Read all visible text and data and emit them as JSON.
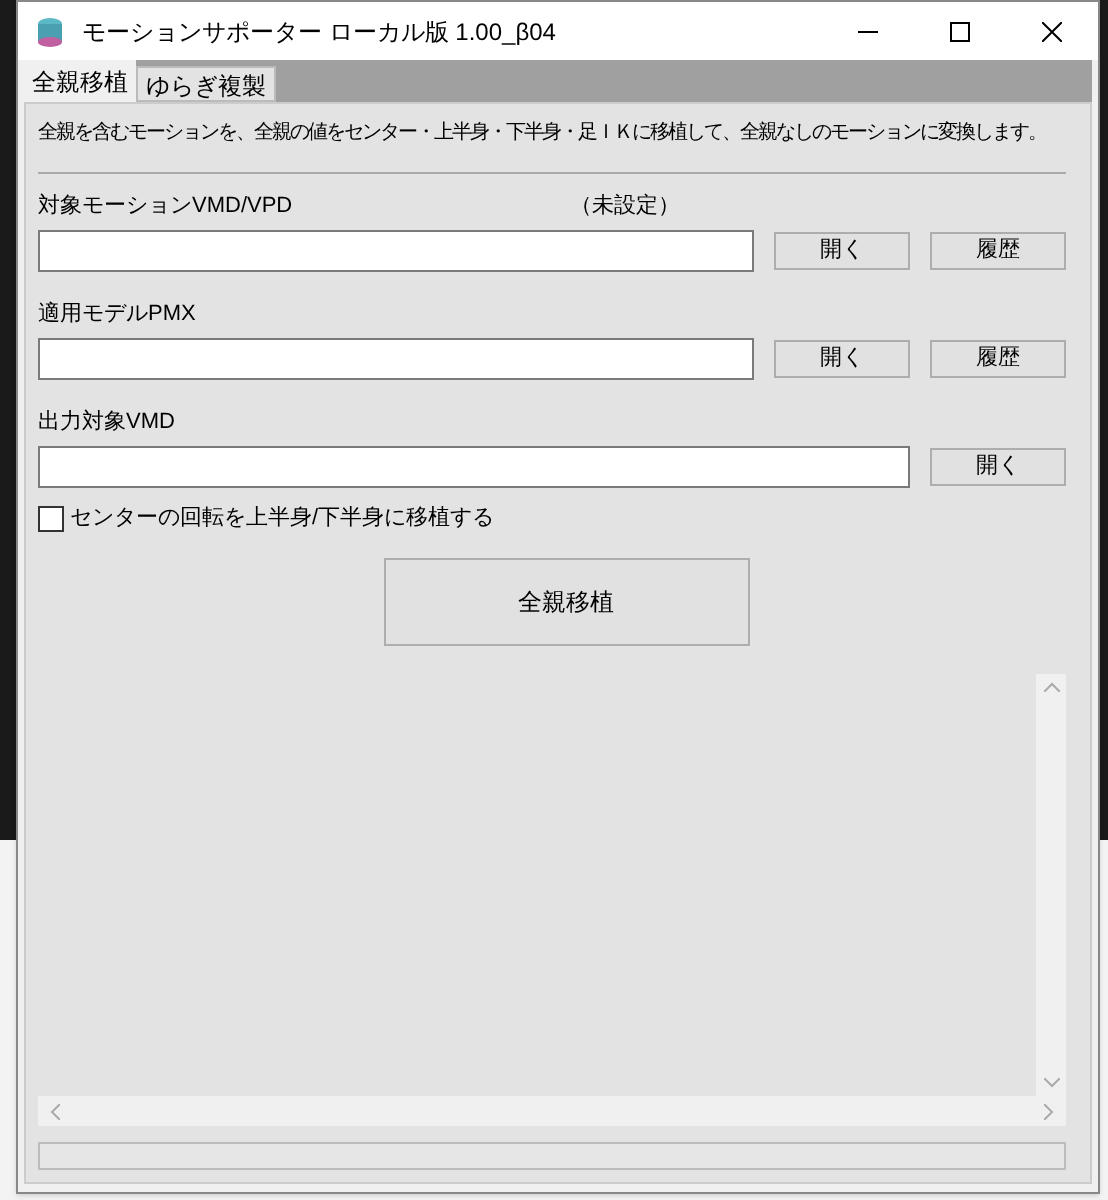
{
  "window": {
    "title": "モーションサポーター ローカル版 1.00_β04"
  },
  "tabs": [
    {
      "label": "全親移植",
      "selected": true
    },
    {
      "label": "ゆらぎ複製",
      "selected": false
    }
  ],
  "description": "全親を含むモーションを、全親の値をセンター・上半身・下半身・足ＩＫに移植して、全親なしのモーションに変換します。",
  "fields": [
    {
      "label": "対象モーションVMD/VPD",
      "status": "（未設定）",
      "buttons": [
        "開く",
        "履歴"
      ]
    },
    {
      "label": "適用モデルPMX",
      "buttons": [
        "開く",
        "履歴"
      ]
    },
    {
      "label": "出力対象VMD",
      "buttons": [
        "開く"
      ]
    }
  ],
  "option": {
    "label": "センターの回転を上半身/下半身に移植する",
    "checked": false
  },
  "action_button": "全親移植",
  "progress": {
    "level": 0
  }
}
